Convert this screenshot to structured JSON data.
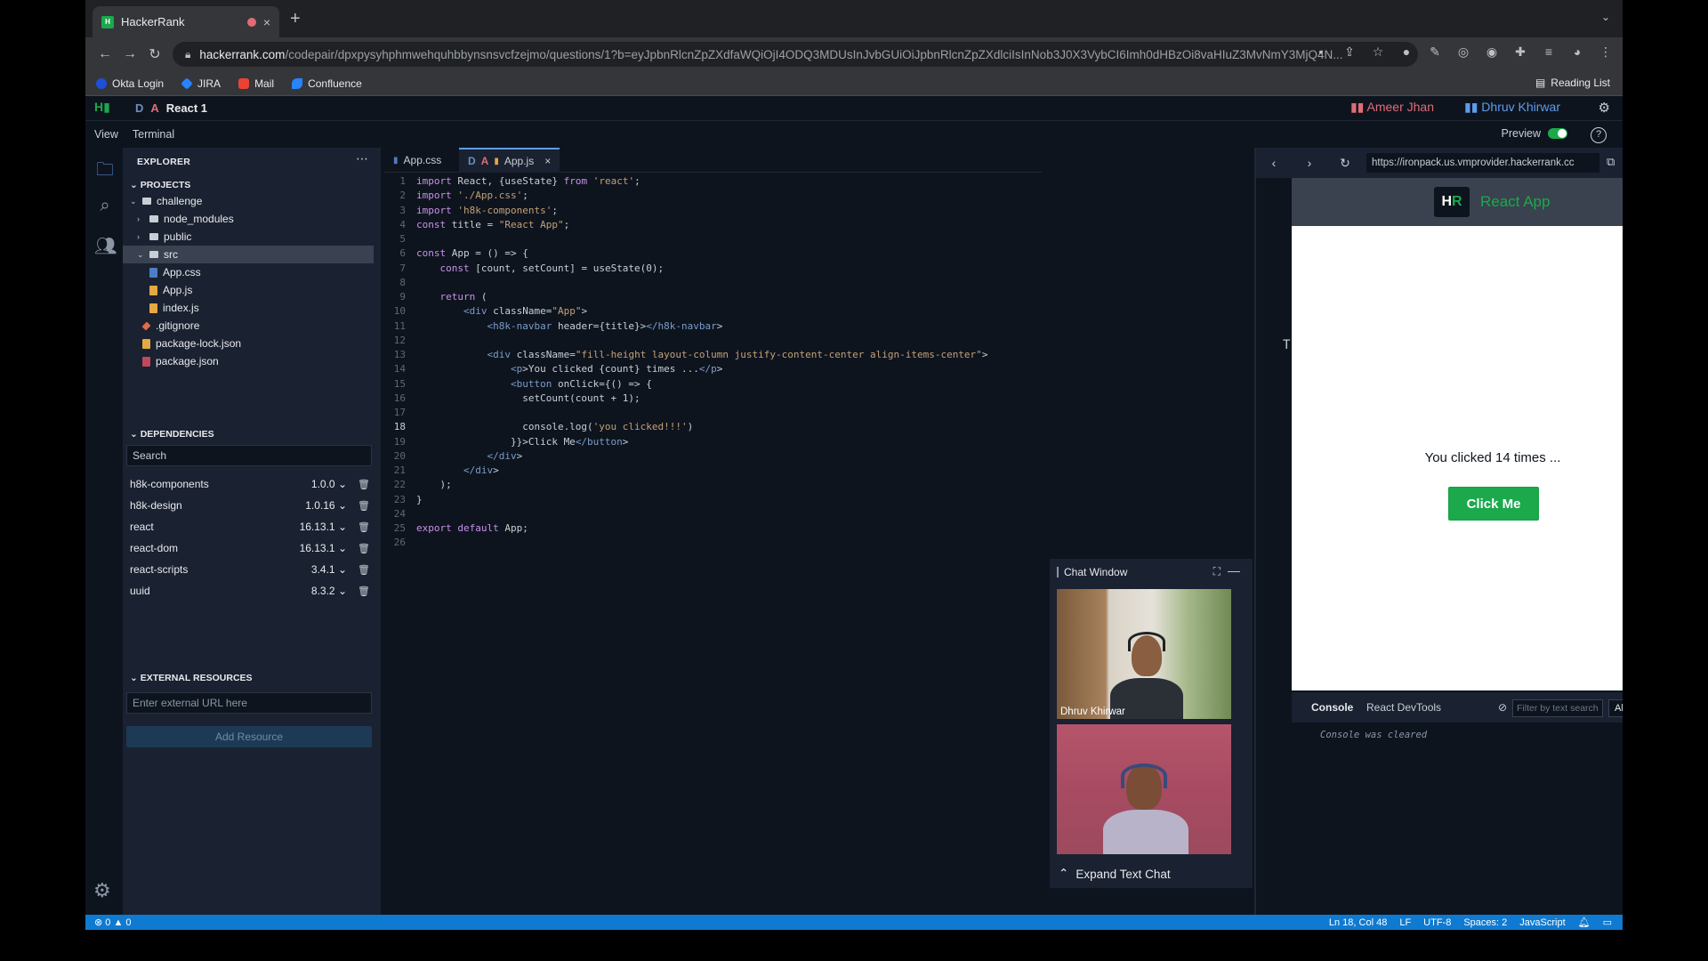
{
  "browser": {
    "tab_title": "HackerRank",
    "url_host": "hackerrank.com",
    "url_path": "/codepair/dpxpysyhphmwehquhbbynsnsvcfzejmo/questions/1?b=eyJpbnRlcnZpZXdfaWQiOjI4ODQ3MDUsInJvbGUiOiJpbnRlcnZpZXdlciIsInNob3J0X3VybCI6Imh0dHBzOi8vaHIuZ3MvNmY3MjQ4N...",
    "bookmarks": [
      "Okta Login",
      "JIRA",
      "Mail",
      "Confluence"
    ],
    "reading_list": "Reading List"
  },
  "app": {
    "project_prefix_d": "D",
    "project_prefix_a": "A",
    "project_name": "React 1",
    "participants": [
      "Ameer Jhan",
      "Dhruv Khirwar"
    ],
    "menu": [
      "View",
      "Terminal"
    ],
    "preview_label": "Preview"
  },
  "explorer": {
    "title": "EXPLORER",
    "projects_label": "PROJECTS",
    "tree": [
      "challenge",
      "node_modules",
      "public",
      "src",
      "App.css",
      "App.js",
      "index.js",
      ".gitignore",
      "package-lock.json",
      "package.json"
    ],
    "dependencies_label": "DEPENDENCIES",
    "search_placeholder": "Search",
    "dependencies": [
      {
        "name": "h8k-components",
        "version": "1.0.0"
      },
      {
        "name": "h8k-design",
        "version": "1.0.16"
      },
      {
        "name": "react",
        "version": "16.13.1"
      },
      {
        "name": "react-dom",
        "version": "16.13.1"
      },
      {
        "name": "react-scripts",
        "version": "3.4.1"
      },
      {
        "name": "uuid",
        "version": "8.3.2"
      }
    ],
    "external_label": "EXTERNAL RESOURCES",
    "external_placeholder": "Enter external URL here",
    "add_resource": "Add Resource"
  },
  "editor": {
    "tabs": [
      {
        "label": "App.css"
      },
      {
        "prefix_d": "D",
        "prefix_a": "A",
        "label": "App.js"
      }
    ],
    "lines": [
      "import React, {useState} from 'react';",
      "import './App.css';",
      "import 'h8k-components';",
      "const title = \"React App\";",
      "",
      "const App = () => {",
      "    const [count, setCount] = useState(0);",
      "",
      "    return (",
      "        <div className=\"App\">",
      "            <h8k-navbar header={title}></h8k-navbar>",
      "",
      "            <div className=\"fill-height layout-column justify-content-center align-items-center\">",
      "                <p>You clicked {count} times ...</p>",
      "                <button onClick={() => {",
      "                  setCount(count + 1);",
      "",
      "                  console.log('you clicked!!!')",
      "                }}>Click Me</button>",
      "            </div>",
      "        </div>",
      "    );",
      "}",
      "",
      "export default App;",
      ""
    ],
    "current_line": 18,
    "margin_marker": "T"
  },
  "chat": {
    "title": "Chat Window",
    "participant_1": "Dhruv Khirwar",
    "expand_label": "Expand Text Chat"
  },
  "preview": {
    "url": "https://ironpack.us.vmprovider.hackerrank.cc",
    "app_title": "React App",
    "logo_h": "H",
    "logo_r": "R",
    "clicked_text": "You clicked 14 times ...",
    "button_label": "Click Me"
  },
  "console": {
    "tabs": [
      "Console",
      "React DevTools"
    ],
    "filter_placeholder": "Filter by text search",
    "level": "All",
    "message": "Console was cleared"
  },
  "statusbar": {
    "errors": "0",
    "warnings": "0",
    "position": "Ln 18, Col 48",
    "eol": "LF",
    "encoding": "UTF-8",
    "spaces": "Spaces: 2",
    "language": "JavaScript"
  },
  "colors": {
    "brand_green": "#1ba94c",
    "accent_blue": "#5d9cec",
    "status_blue": "#0e7ad1"
  }
}
